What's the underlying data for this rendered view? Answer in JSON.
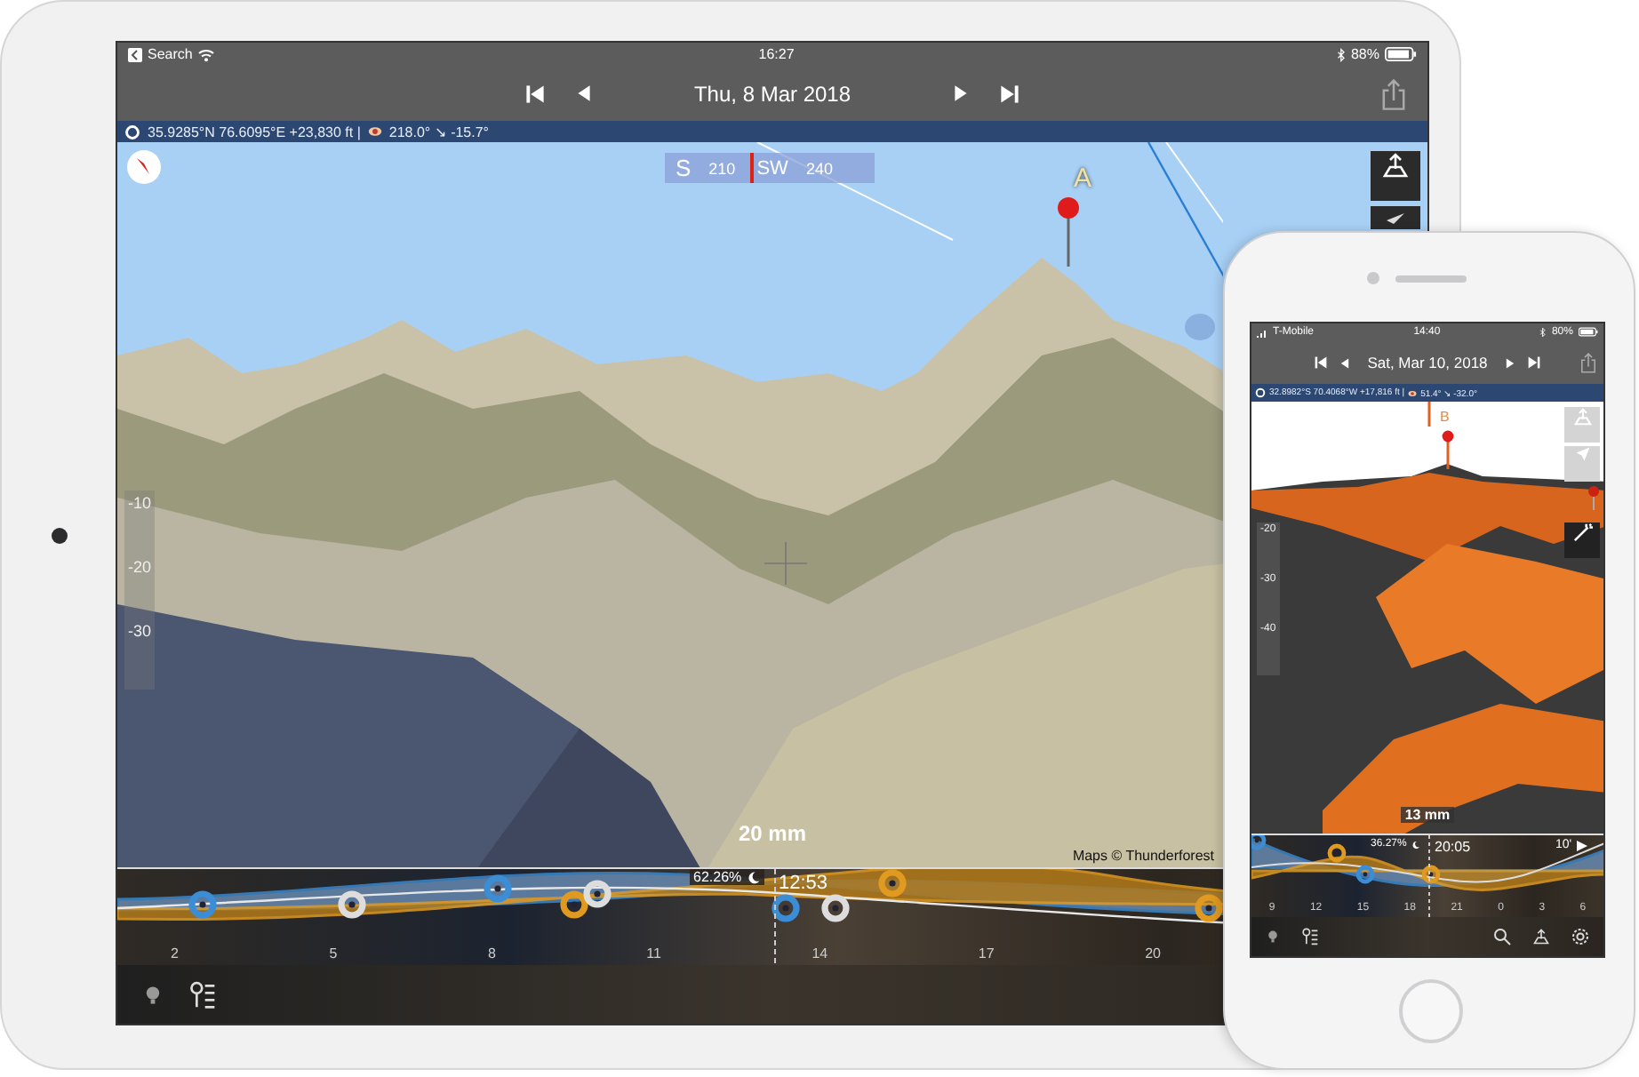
{
  "tablet": {
    "status_bar": {
      "back_label": "Search",
      "time": "16:27",
      "battery": "88%"
    },
    "date": "Thu, 8 Mar 2018",
    "info_bar": {
      "coordinates": "35.9285°N 76.6095°E +23,830 ft |",
      "view": "218.0° ↘ -15.7°"
    },
    "compass_strip": [
      "S",
      "210",
      "SW",
      "240"
    ],
    "marker_label": "A",
    "elevation_scale": [
      "-10",
      "-20",
      "-30"
    ],
    "focal_length": "20 mm",
    "credit": "Maps © Thunderforest",
    "timeline": {
      "moon_illumination": "62.26%",
      "time": "12:53",
      "hours": [
        "2",
        "5",
        "8",
        "11",
        "14",
        "17",
        "20"
      ]
    }
  },
  "phone": {
    "status_bar": {
      "carrier": "T-Mobile",
      "time": "14:40",
      "battery": "80%"
    },
    "date": "Sat, Mar 10, 2018",
    "info_bar": {
      "coordinates": "32.8982°S 70.4068°W +17,816 ft |",
      "view": "51.4° ↘ -32.0°"
    },
    "marker_label": "B",
    "elevation_scale": [
      "-20",
      "-30",
      "-40"
    ],
    "focal_length": "13 mm",
    "timeline": {
      "moon_illumination": "36.27%",
      "time": "20:05",
      "step": "10'",
      "hours": [
        "9",
        "12",
        "15",
        "18",
        "21",
        "0",
        "3",
        "6"
      ]
    }
  }
}
